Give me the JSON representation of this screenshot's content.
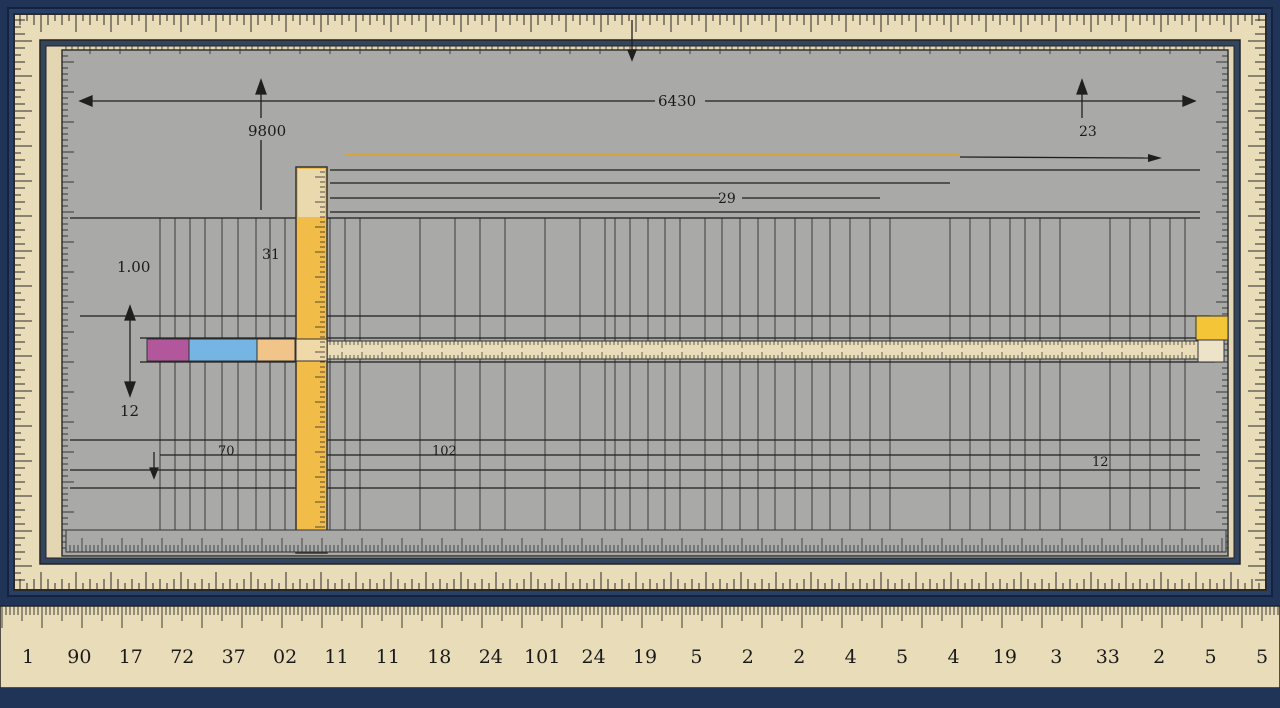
{
  "diagram": {
    "labels": {
      "top_dimension": "6430",
      "left_dimension": "9800",
      "right_dimension": "23",
      "middle_dimension": "29",
      "inner_dimension": "31",
      "left_height": "1.00",
      "left_depth": "12",
      "small_a": "70",
      "small_b": "102",
      "small_c": "12"
    },
    "bottom_scale_labels": [
      "1",
      "90",
      "17",
      "72",
      "37",
      "02",
      "11",
      "11",
      "18",
      "24",
      "101",
      "24",
      "19",
      "5",
      "2",
      "2",
      "4",
      "5",
      "4",
      "19",
      "3",
      "33",
      "2",
      "5",
      "5"
    ],
    "colors": {
      "frame": "#1f3457",
      "ruler_tan": "#e9dcb8",
      "panel_gray": "#a9aaa8",
      "ruler_yellow": "#f1bd48",
      "swatch_magenta": "#b2579b",
      "swatch_blue": "#74b5e4",
      "swatch_orange": "#f1c58a",
      "marker_yellow": "#f3c537"
    }
  }
}
